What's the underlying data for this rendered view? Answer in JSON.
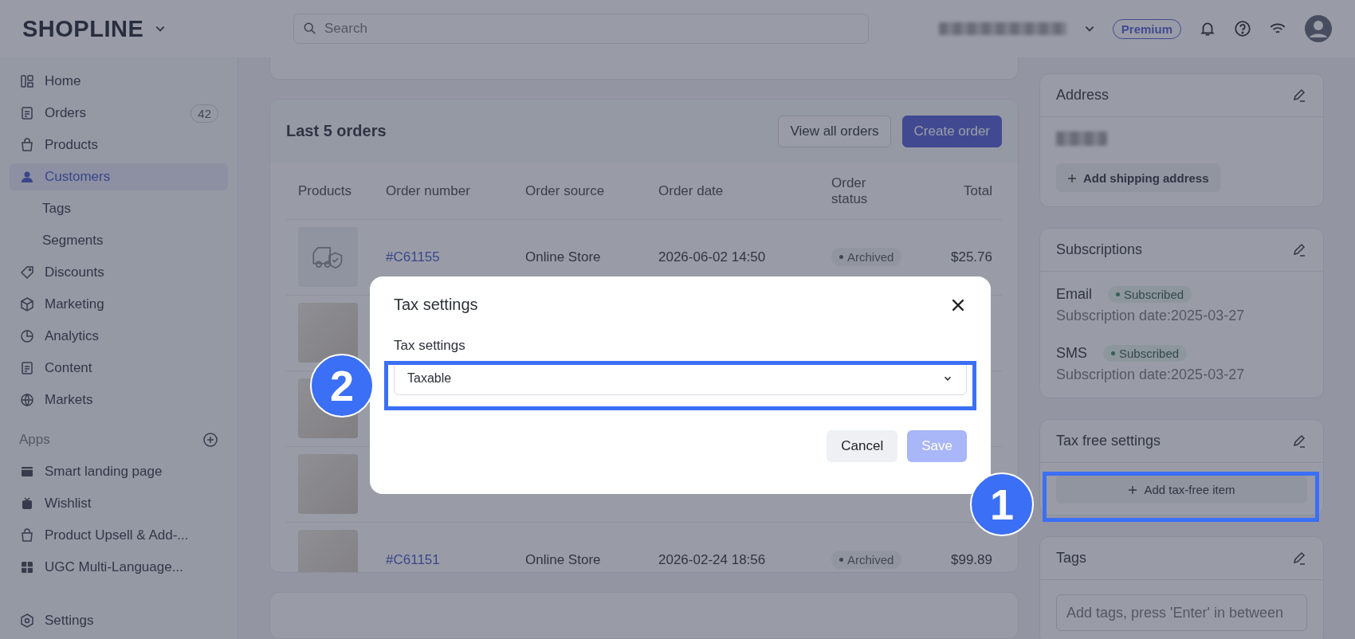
{
  "topbar": {
    "logo": "SHOPLINE",
    "search": {
      "placeholder": "Search"
    },
    "plan_badge": "Premium"
  },
  "sidebar": {
    "items": [
      {
        "label": "Home",
        "selected": false
      },
      {
        "label": "Orders",
        "badge": "42",
        "selected": false
      },
      {
        "label": "Products",
        "selected": false
      },
      {
        "label": "Customers",
        "selected": true,
        "children": [
          {
            "label": "Tags",
            "selected": false
          },
          {
            "label": "Segments",
            "selected": false
          }
        ]
      },
      {
        "label": "Discounts",
        "selected": false
      },
      {
        "label": "Marketing",
        "selected": false
      },
      {
        "label": "Analytics",
        "selected": false
      },
      {
        "label": "Content",
        "selected": false
      },
      {
        "label": "Markets",
        "selected": false
      }
    ],
    "apps_heading": "Apps",
    "apps": [
      {
        "label": "Smart landing page"
      },
      {
        "label": "Wishlist"
      },
      {
        "label": "Product Upsell & Add-..."
      },
      {
        "label": "UGC Multi-Language..."
      }
    ],
    "footer_item": {
      "label": "Settings"
    }
  },
  "orders_card": {
    "title": "Last 5 orders",
    "buttons": [
      {
        "label": "View all orders",
        "kind": "secondary"
      },
      {
        "label": "Create order",
        "kind": "primary"
      }
    ],
    "columns": [
      "Products",
      "Order number",
      "Order source",
      "Order date",
      "Order\nstatus",
      "Total"
    ],
    "rows": [
      {
        "kind": "icon",
        "order_number": "#C61155",
        "source": "Online Store",
        "date": "2026-06-02 14:50",
        "status": "Archived",
        "total": "$25.76"
      },
      {
        "kind": "photo"
      },
      {
        "kind": "photo"
      },
      {
        "kind": "photo"
      },
      {
        "kind": "photo",
        "order_number": "#C61151",
        "source": "Online Store",
        "date": "2026-02-24 18:56",
        "status": "Archived",
        "total": "$99.89"
      }
    ]
  },
  "address_card": {
    "title": "Address",
    "button": "Add shipping address"
  },
  "subscriptions_card": {
    "title": "Subscriptions",
    "channels": [
      {
        "name": "Email",
        "status": "Subscribed",
        "date": "Subscription date:2025-03-27"
      },
      {
        "name": "SMS",
        "status": "Subscribed",
        "date": "Subscription date:2025-03-27"
      }
    ]
  },
  "tax_free_card": {
    "title": "Tax free settings",
    "button": "Add tax-free item"
  },
  "tags_card": {
    "title": "Tags",
    "input": {
      "placeholder": "Add tags, press 'Enter' in between"
    }
  },
  "dialog": {
    "title": "Tax settings",
    "field_label": "Tax settings",
    "select_value": "Taxable",
    "buttons": [
      {
        "label": "Cancel",
        "kind": "secondary",
        "disabled": false
      },
      {
        "label": "Save",
        "kind": "primary",
        "disabled": true
      }
    ]
  },
  "annotations": [
    {
      "label": "1"
    },
    {
      "label": "2"
    }
  ]
}
